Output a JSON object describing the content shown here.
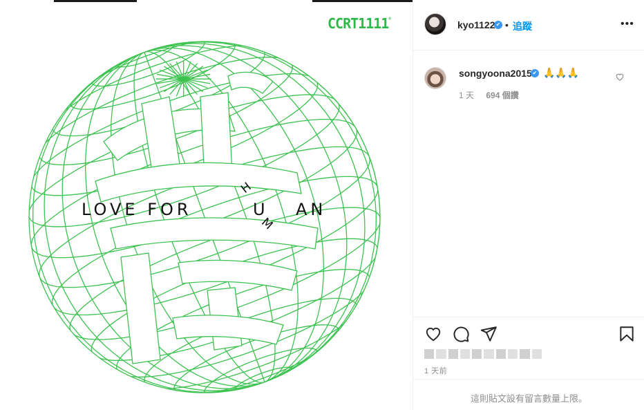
{
  "media": {
    "brand": "CCRT1111",
    "brand_mark": "®",
    "tagline_left": "LOVE FOR",
    "tagline_u": "U",
    "tagline_h": "H",
    "tagline_m": "M",
    "tagline_right": "AN",
    "colors": {
      "globe_line": "#3cc24f",
      "brand": "#2fb84a"
    }
  },
  "header": {
    "author": "kyo1122",
    "verified_mark": "✔",
    "separator": "•",
    "follow_label": "追蹤",
    "more_label": "•••"
  },
  "comment": {
    "username": "songyoona2015",
    "verified_mark": "✔",
    "text": "🙏🙏🙏",
    "time": "1 天",
    "likes": "694 個讚"
  },
  "actions": {
    "like_icon": "heart-icon",
    "comment_icon": "comment-icon",
    "share_icon": "paper-plane-icon",
    "save_icon": "bookmark-icon"
  },
  "posted_time": "1 天前",
  "comments_limit_notice": "這則貼文設有留言數量上限。"
}
